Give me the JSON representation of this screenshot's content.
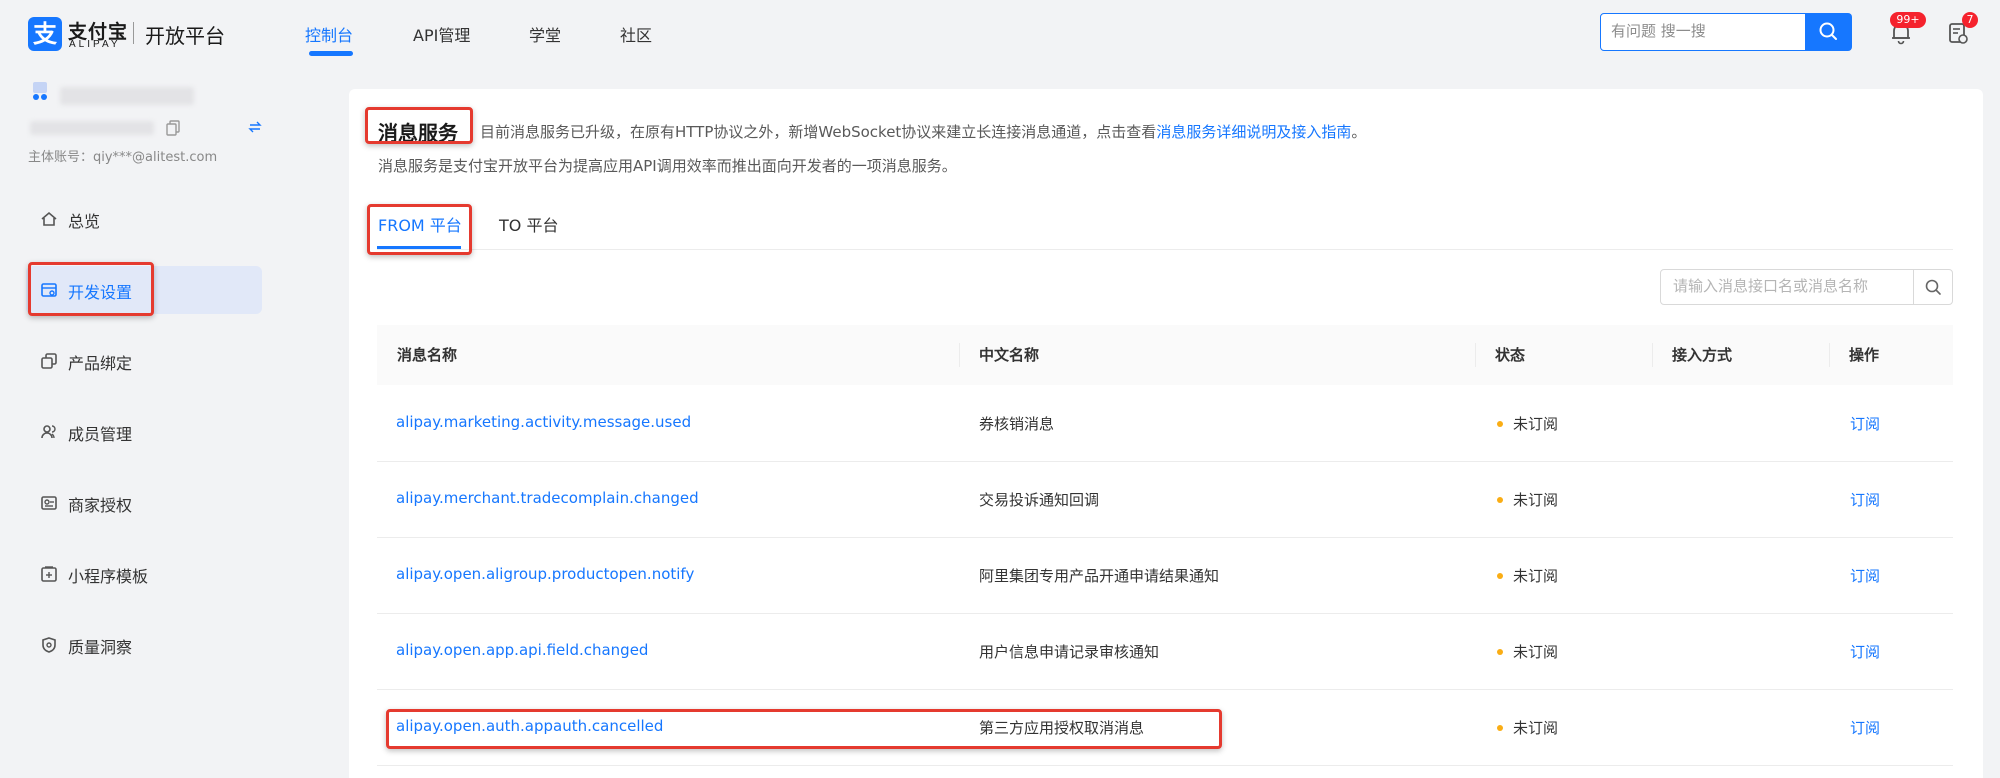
{
  "header": {
    "logo_text": "支付宝",
    "logo_sub": "ALIPAY",
    "platform": "开放平台",
    "nav": [
      {
        "label": "控制台",
        "active": true
      },
      {
        "label": "API管理"
      },
      {
        "label": "学堂"
      },
      {
        "label": "社区"
      }
    ],
    "search_placeholder": "有问题 搜一搜",
    "notification_badge": "99+",
    "task_badge": "7"
  },
  "sidebar": {
    "account_label": "主体账号：qiy***@alitest.com",
    "items": [
      {
        "label": "总览",
        "icon": "home-icon"
      },
      {
        "label": "开发设置",
        "icon": "dev-settings-icon",
        "active": true
      },
      {
        "label": "产品绑定",
        "icon": "product-binding-icon"
      },
      {
        "label": "成员管理",
        "icon": "members-icon"
      },
      {
        "label": "商家授权",
        "icon": "merchant-auth-icon"
      },
      {
        "label": "小程序模板",
        "icon": "miniapp-template-icon"
      },
      {
        "label": "质量洞察",
        "icon": "quality-shield-icon"
      }
    ]
  },
  "main": {
    "title": "消息服务",
    "notice_text": "目前消息服务已升级，在原有HTTP协议之外，新增WebSocket协议来建立长连接消息通道，点击查看",
    "notice_link": "消息服务详细说明及接入指南",
    "notice_end": "。",
    "description": "消息服务是支付宝开放平台为提高应用API调用效率而推出面向开发者的一项消息服务。",
    "tabs": [
      {
        "label": "FROM 平台",
        "active": true
      },
      {
        "label": "TO 平台"
      }
    ],
    "table_search_placeholder": "请输入消息接口名或消息名称",
    "columns": [
      "消息名称",
      "中文名称",
      "状态",
      "接入方式",
      "操作"
    ],
    "rows": [
      {
        "name": "alipay.marketing.activity.message.used",
        "cn": "券核销消息",
        "status": "未订阅",
        "method": "",
        "action": "订阅"
      },
      {
        "name": "alipay.merchant.tradecomplain.changed",
        "cn": "交易投诉通知回调",
        "status": "未订阅",
        "method": "",
        "action": "订阅"
      },
      {
        "name": "alipay.open.aligroup.productopen.notify",
        "cn": "阿里集团专用产品开通申请结果通知",
        "status": "未订阅",
        "method": "",
        "action": "订阅"
      },
      {
        "name": "alipay.open.app.api.field.changed",
        "cn": "用户信息申请记录审核通知",
        "status": "未订阅",
        "method": "",
        "action": "订阅"
      },
      {
        "name": "alipay.open.auth.appauth.cancelled",
        "cn": "第三方应用授权取消消息",
        "status": "未订阅",
        "method": "",
        "action": "订阅"
      }
    ]
  },
  "colors": {
    "accent": "#1677ff",
    "highlight": "#e53a2f",
    "status_dot": "#faad14"
  }
}
